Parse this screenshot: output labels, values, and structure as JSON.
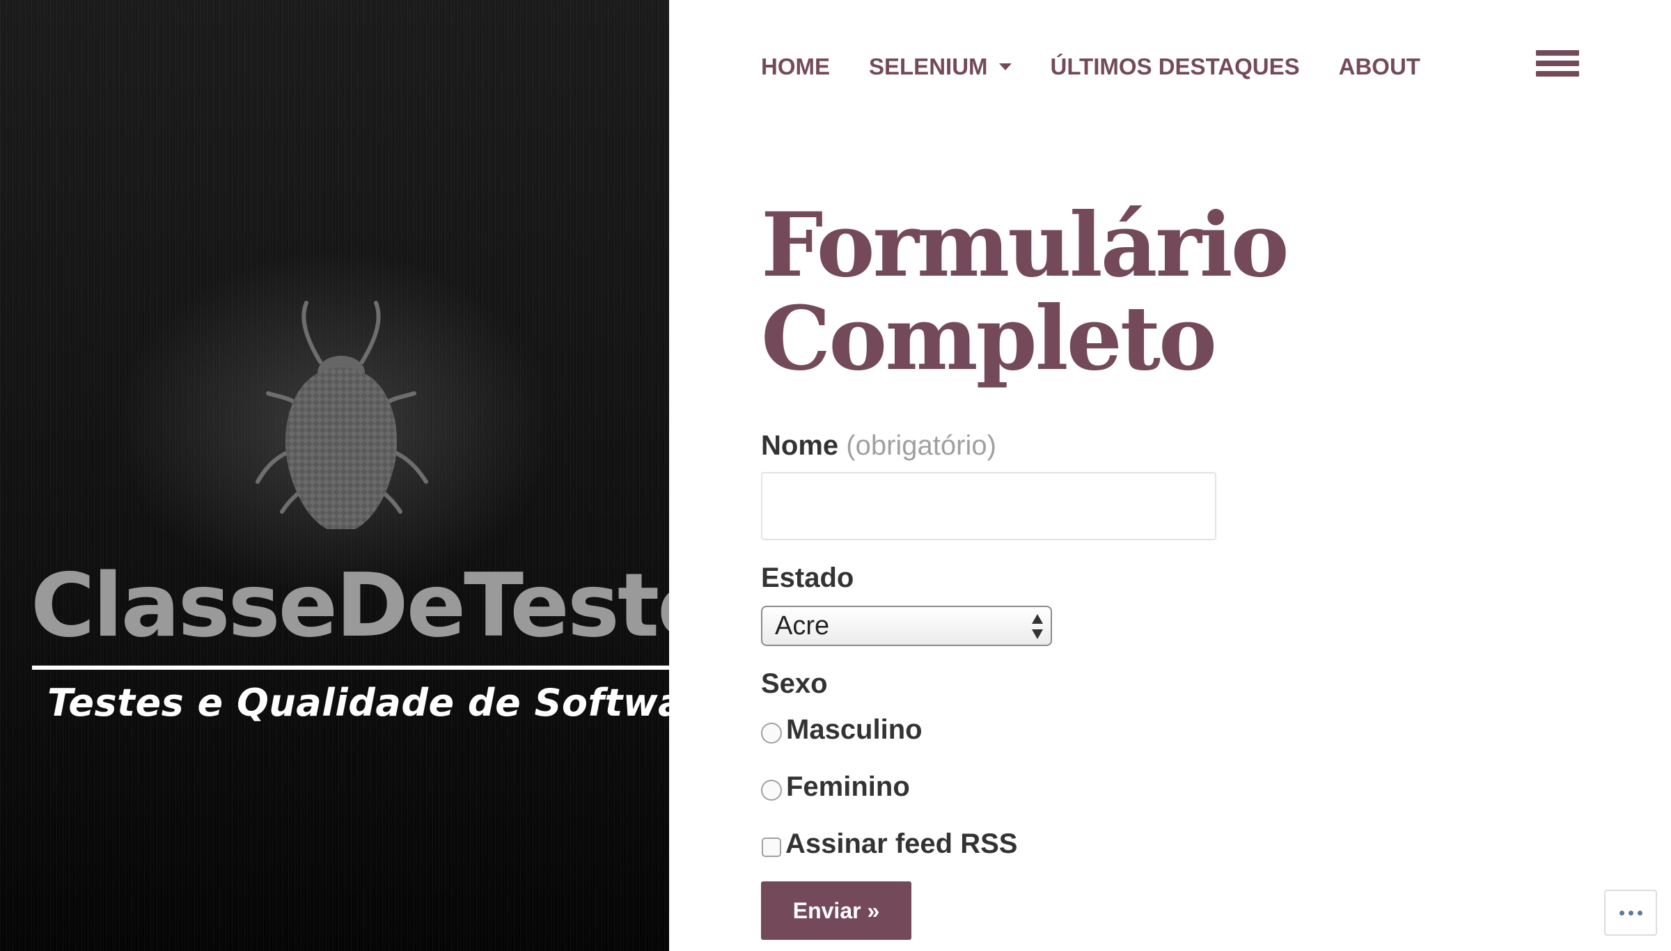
{
  "hero": {
    "brand": "ClasseDeTestes",
    "tagline": "Testes e Qualidade de Software"
  },
  "nav": {
    "items": [
      {
        "label": "HOME"
      },
      {
        "label": "SELENIUM",
        "has_dropdown": true
      },
      {
        "label": "ÚLTIMOS DESTAQUES"
      },
      {
        "label": "ABOUT"
      }
    ],
    "menu_icon": "hamburger-icon"
  },
  "page": {
    "title": "Formulário Completo"
  },
  "form": {
    "nome": {
      "label": "Nome",
      "required_note": "(obrigatório)",
      "value": ""
    },
    "estado": {
      "label": "Estado",
      "selected": "Acre"
    },
    "sexo": {
      "label": "Sexo",
      "options": [
        {
          "label": "Masculino",
          "checked": false
        },
        {
          "label": "Feminino",
          "checked": false
        }
      ]
    },
    "rss": {
      "label": "Assinar feed RSS",
      "checked": false
    },
    "submit_label": "Enviar »"
  },
  "overlay": {
    "more_icon": "ellipsis-icon"
  },
  "colors": {
    "accent": "#744a5a",
    "text": "#333333",
    "muted": "#a0a0a0",
    "hero_bg": "#0d0d0d"
  }
}
